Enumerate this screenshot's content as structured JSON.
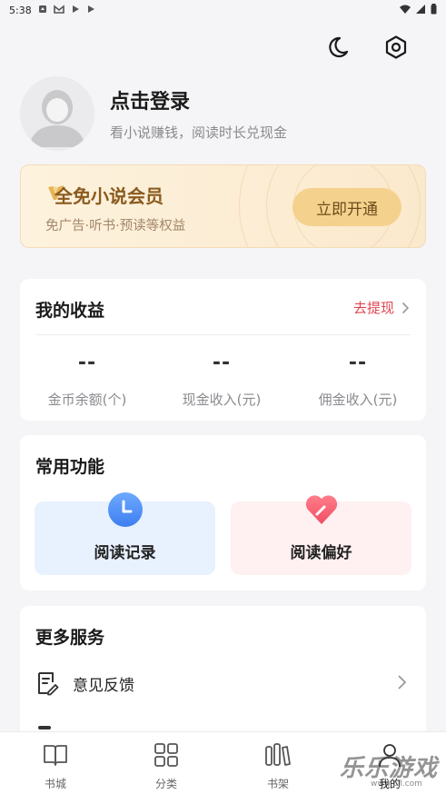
{
  "status_bar": {
    "time": "5:38",
    "left_icons": [
      "notification-icon",
      "mail-icon",
      "play-icon",
      "play-icon"
    ],
    "right_icons": [
      "wifi-icon",
      "signal-icon",
      "battery-icon"
    ]
  },
  "top_actions": [
    "moon-icon",
    "settings-icon"
  ],
  "profile": {
    "title": "点击登录",
    "subtitle": "看小说赚钱，阅读时长兑现金"
  },
  "vip": {
    "title": "全免小说会员",
    "subtitle": "免广告·听书·预读等权益",
    "button": "立即开通",
    "colors": {
      "title": "#8a5a1d",
      "button_bg": "#f4d28e"
    }
  },
  "earnings": {
    "title": "我的收益",
    "link": "去提现",
    "stats": [
      {
        "value": "--",
        "label": "金币余额(个)"
      },
      {
        "value": "--",
        "label": "现金收入(元)"
      },
      {
        "value": "--",
        "label": "佣金收入(元)"
      }
    ]
  },
  "functions": {
    "title": "常用功能",
    "items": [
      {
        "label": "阅读记录",
        "icon": "clock-icon"
      },
      {
        "label": "阅读偏好",
        "icon": "heart-icon"
      }
    ]
  },
  "services": {
    "title": "更多服务",
    "items": [
      {
        "label": "意见反馈",
        "icon": "feedback-icon"
      }
    ]
  },
  "bottom_nav": [
    {
      "label": "书城",
      "icon": "book-icon"
    },
    {
      "label": "分类",
      "icon": "grid-icon"
    },
    {
      "label": "书架",
      "icon": "bookshelf-icon"
    },
    {
      "label": "我的",
      "icon": "user-icon"
    }
  ],
  "watermark": {
    "text": "乐乐游戏",
    "url": "www.6ll.com"
  },
  "colors": {
    "accent_red": "#e2444f",
    "background": "#f5f5f7"
  }
}
